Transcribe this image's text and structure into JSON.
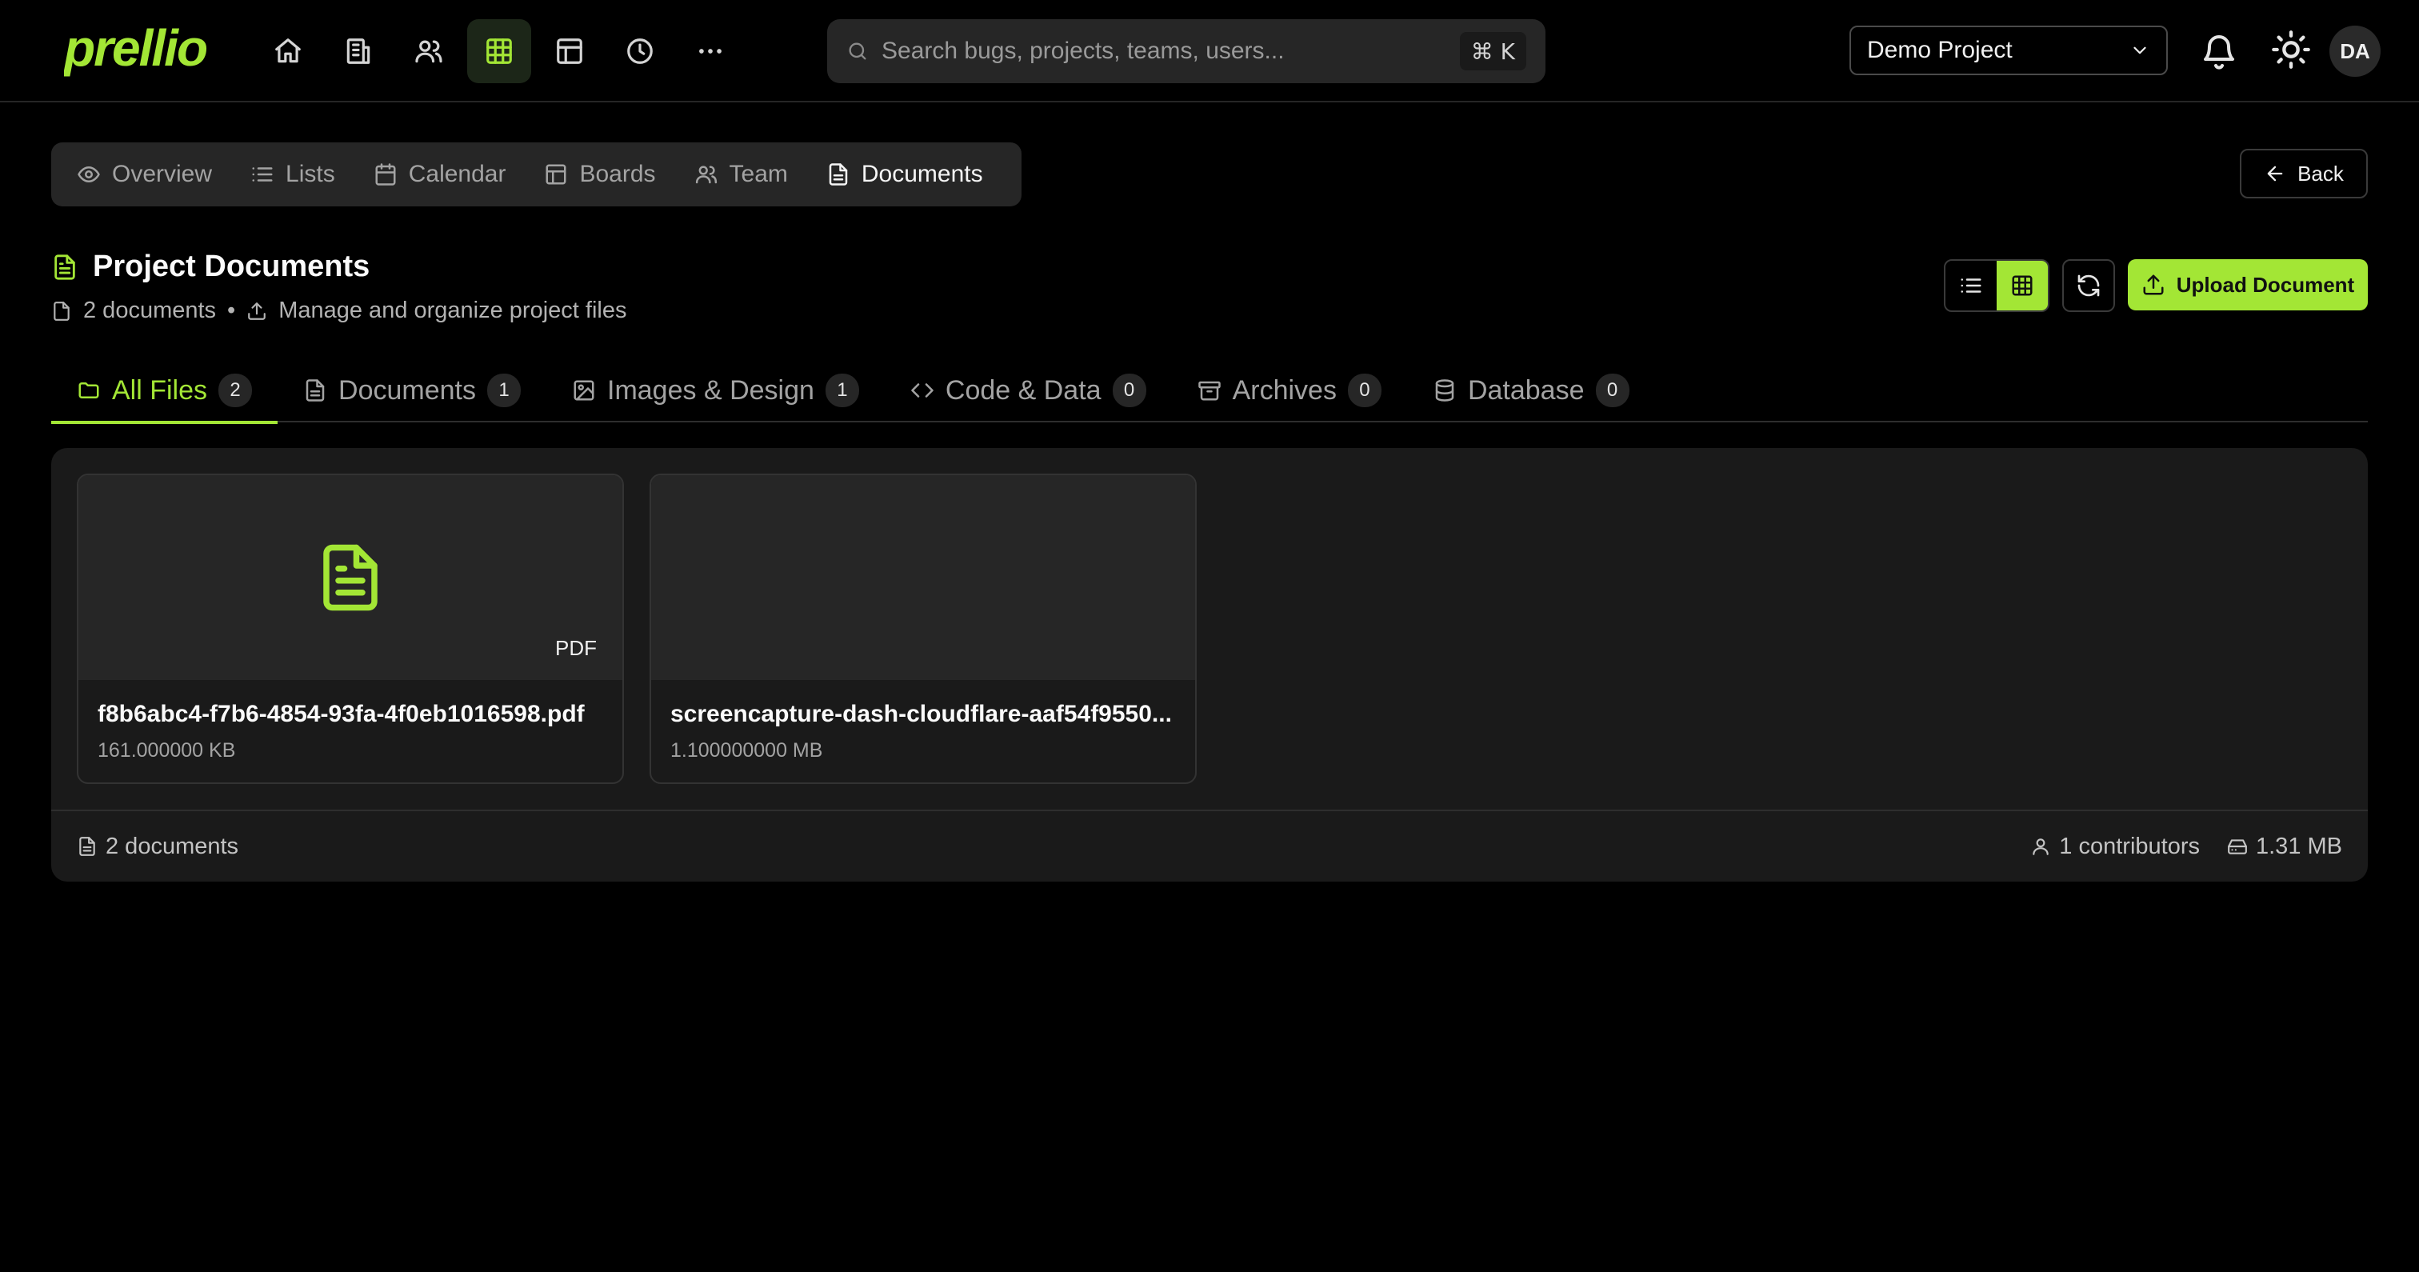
{
  "app": {
    "logo_text": "prellio",
    "accent_color": "#a3e635"
  },
  "topnav": {
    "icons": [
      "home-icon",
      "building-icon",
      "users-icon",
      "grid-icon",
      "layout-icon",
      "clock-icon",
      "more-icon"
    ],
    "active": "grid-icon"
  },
  "search": {
    "placeholder": "Search bugs, projects, teams, users...",
    "shortcut": "⌘ K"
  },
  "project_select": {
    "value": "Demo Project"
  },
  "user": {
    "initials": "DA"
  },
  "section_tabs": [
    {
      "label": "Overview",
      "icon": "eye-icon"
    },
    {
      "label": "Lists",
      "icon": "list-icon"
    },
    {
      "label": "Calendar",
      "icon": "calendar-icon"
    },
    {
      "label": "Boards",
      "icon": "board-icon"
    },
    {
      "label": "Team",
      "icon": "users-icon"
    },
    {
      "label": "Documents",
      "icon": "file-icon",
      "active": true
    }
  ],
  "back_label": "Back",
  "page": {
    "title": "Project Documents",
    "doc_count": "2 documents",
    "separator": "•",
    "subtitle": "Manage and organize project files"
  },
  "actions": {
    "upload_label": "Upload Document"
  },
  "file_tabs": [
    {
      "label": "All Files",
      "count": "2",
      "icon": "folder-icon",
      "active": true
    },
    {
      "label": "Documents",
      "count": "1",
      "icon": "file-icon"
    },
    {
      "label": "Images & Design",
      "count": "1",
      "icon": "image-icon"
    },
    {
      "label": "Code & Data",
      "count": "0",
      "icon": "code-icon"
    },
    {
      "label": "Archives",
      "count": "0",
      "icon": "archive-icon"
    },
    {
      "label": "Database",
      "count": "0",
      "icon": "database-icon"
    }
  ],
  "documents": [
    {
      "name": "f8b6abc4-f7b6-4854-93fa-4f0eb1016598.pdf",
      "size": "161.000000 KB",
      "type": "PDF",
      "thumb": "file-text-icon"
    },
    {
      "name": "screencapture-dash-cloudflare-aaf54f9550...",
      "size": "1.100000000 MB",
      "type": "",
      "thumb": ""
    }
  ],
  "footer": {
    "doc_count": "2 documents",
    "contributors": "1 contributors",
    "total_size": "1.31 MB"
  }
}
